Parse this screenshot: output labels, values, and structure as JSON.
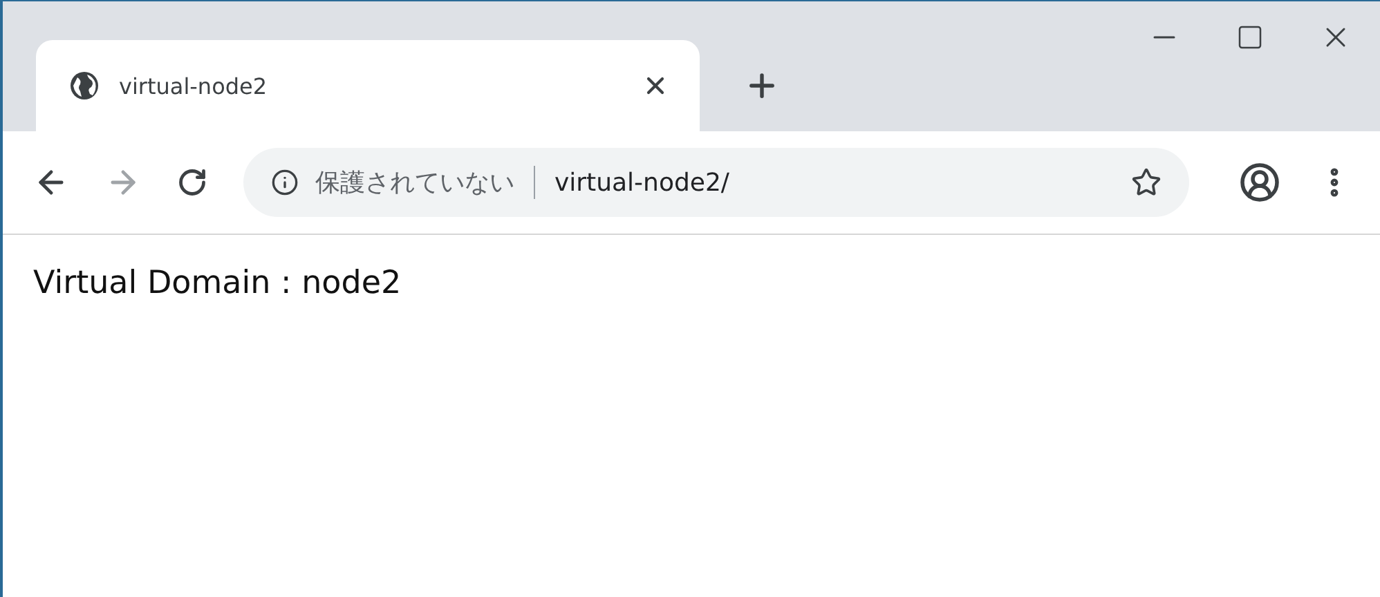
{
  "tabs": [
    {
      "title": "virtual-node2",
      "selected": true
    }
  ],
  "address_bar": {
    "security_label": "保護されていない",
    "url": "virtual-node2/"
  },
  "page": {
    "text": "Virtual Domain : node2"
  }
}
